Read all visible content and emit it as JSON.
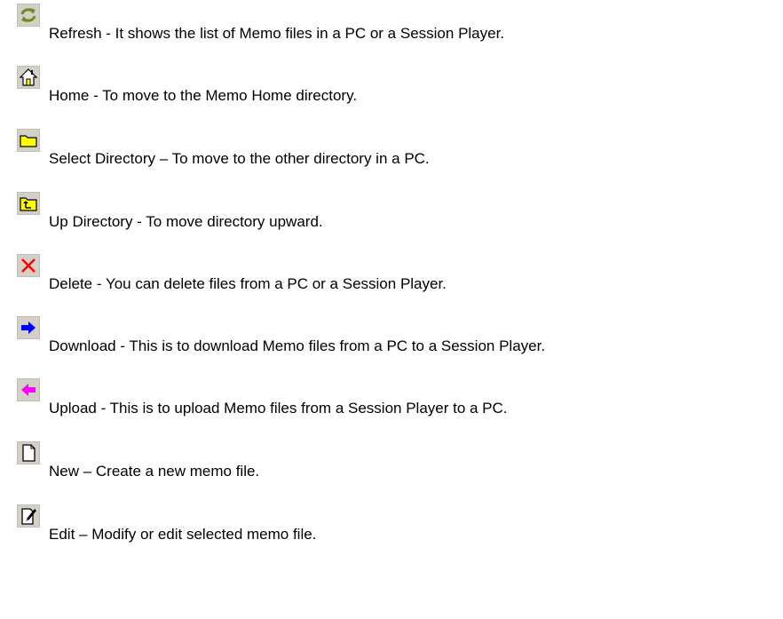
{
  "entries": [
    {
      "icon": "refresh-icon",
      "text": "Refresh - It shows the list of Memo files in a PC or a Session Player."
    },
    {
      "icon": "home-icon",
      "text": "Home - To move to the Memo Home directory."
    },
    {
      "icon": "folder-icon",
      "text": "Select Directory – To move to the other directory in a PC."
    },
    {
      "icon": "up-directory-icon",
      "text": "Up Directory - To move directory upward."
    },
    {
      "icon": "delete-icon",
      "text": "Delete - You can delete files from a PC or a Session Player."
    },
    {
      "icon": "download-arrow-icon",
      "text": "Download - This is to download Memo files from a PC to a Session Player."
    },
    {
      "icon": "upload-arrow-icon",
      "text": "Upload - This is to upload Memo files from a Session Player to a PC."
    },
    {
      "icon": "new-file-icon",
      "text": "New – Create a new memo file."
    },
    {
      "icon": "edit-file-icon",
      "text": "Edit – Modify or edit selected memo file."
    }
  ],
  "colors": {
    "button_face": "#d4d0c8",
    "refresh": "#6b8e23",
    "folder": "#ffff00",
    "delete": "#ff0000",
    "download": "#0000ff",
    "upload": "#ff00ff"
  }
}
